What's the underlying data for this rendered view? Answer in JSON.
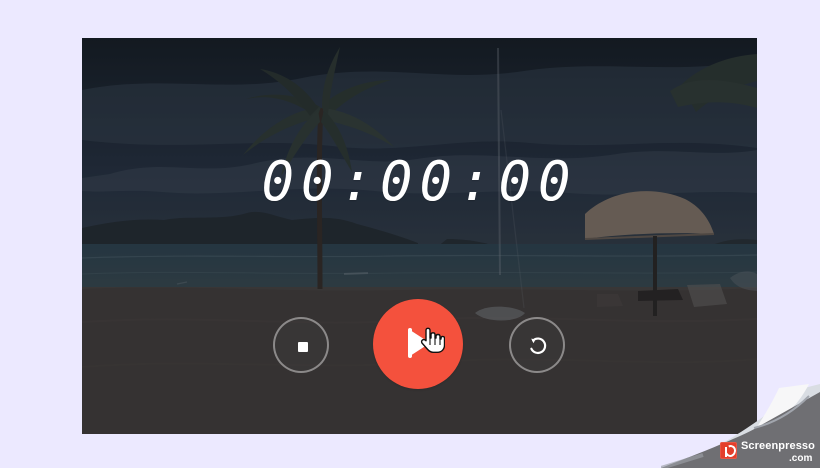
{
  "timer": {
    "display": "00:00:00"
  },
  "controls": [
    {
      "name": "stop",
      "icon": "stop-icon"
    },
    {
      "name": "start",
      "icon": "play-icon",
      "color": "#f4513d"
    },
    {
      "name": "reset",
      "icon": "reset-icon"
    }
  ],
  "background": {
    "image": "beach-palm-umbrella-scene"
  },
  "badge": {
    "brand": "Screenpresso",
    "domain": ".com",
    "accent": "#e43f2c"
  },
  "colors": {
    "page_background": "#ece9ff",
    "primary_action": "#f4513d",
    "text": "#ffffff"
  }
}
